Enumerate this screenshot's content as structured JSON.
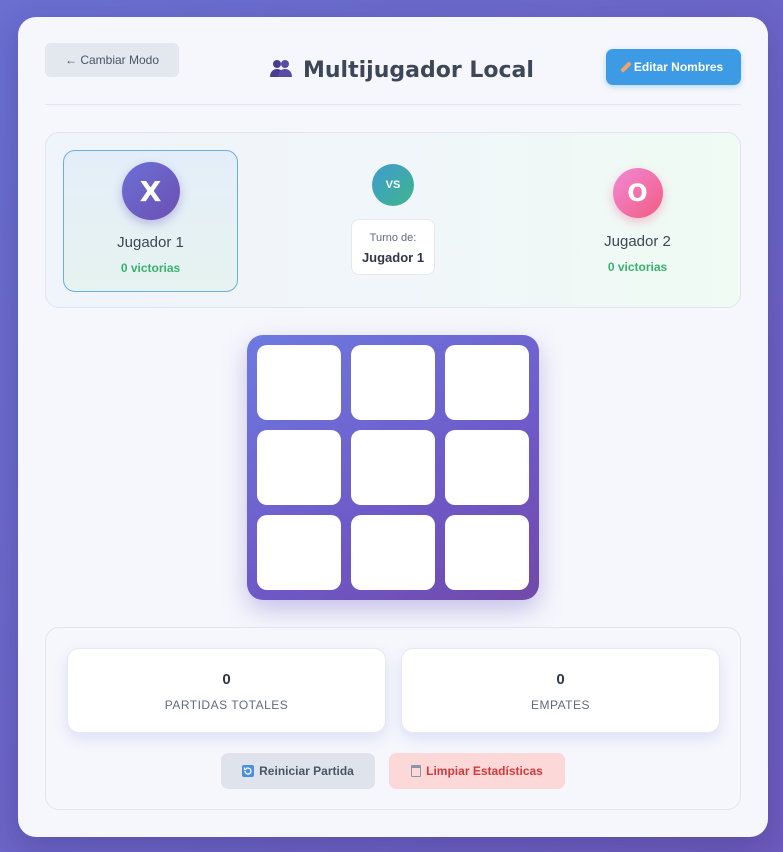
{
  "header": {
    "back_label": "← Cambiar Modo",
    "title": "Multijugador Local",
    "title_icon": "people-icon",
    "edit_label": "Editar Nombres",
    "edit_icon": "pencil-icon"
  },
  "players": {
    "p1": {
      "symbol": "X",
      "name": "Jugador 1",
      "wins": "0 victorias"
    },
    "p2": {
      "symbol": "O",
      "name": "Jugador 2",
      "wins": "0 victorias"
    },
    "vs": "VS",
    "turn_label": "Turno de:",
    "turn_player": "Jugador 1"
  },
  "board": {
    "cells": [
      "",
      "",
      "",
      "",
      "",
      "",
      "",
      "",
      ""
    ]
  },
  "stats": {
    "total_value": "0",
    "total_label": "PARTIDAS TOTALES",
    "draws_value": "0",
    "draws_label": "EMPATES"
  },
  "actions": {
    "reset_label": "Reiniciar Partida",
    "reset_icon": "refresh-icon",
    "clear_label": "Limpiar Estadísticas",
    "clear_icon": "trash-icon"
  },
  "colors": {
    "background": "#6a6fd0",
    "accent_blue": "#3d9be5",
    "win_green": "#38b36e",
    "x_avatar": "#6b70d6",
    "o_avatar": "#f25b82",
    "danger": "#d03a3a"
  }
}
